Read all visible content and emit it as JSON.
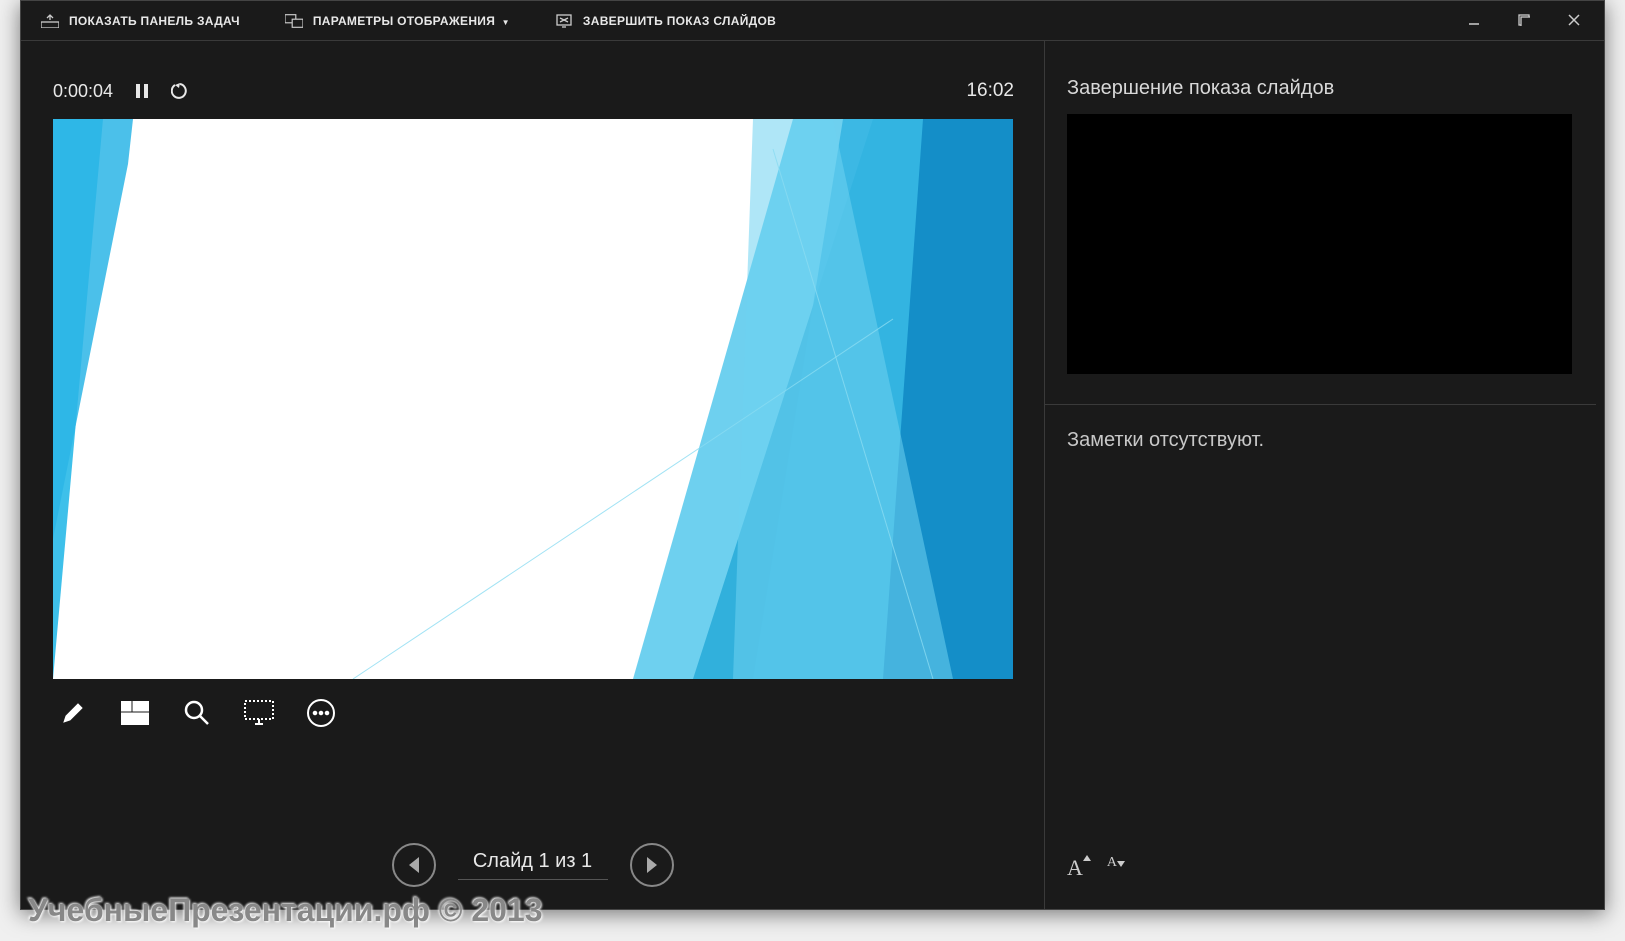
{
  "toolbar": {
    "show_taskbar": "ПОКАЗАТЬ ПАНЕЛЬ ЗАДАЧ",
    "display_settings": "ПАРАМЕТРЫ ОТОБРАЖЕНИЯ",
    "end_show": "ЗАВЕРШИТЬ ПОКАЗ СЛАЙДОВ"
  },
  "timer": {
    "elapsed": "0:00:04",
    "clock": "16:02"
  },
  "right": {
    "next_title": "Завершение показа слайдов",
    "notes": "Заметки отсутствуют."
  },
  "nav": {
    "slide_label": "Слайд 1 из 1"
  },
  "watermark": "УчебныеПрезентации.рф © 2013",
  "colors": {
    "accent1": "#3ec0ea",
    "accent2": "#0e9bd8"
  }
}
